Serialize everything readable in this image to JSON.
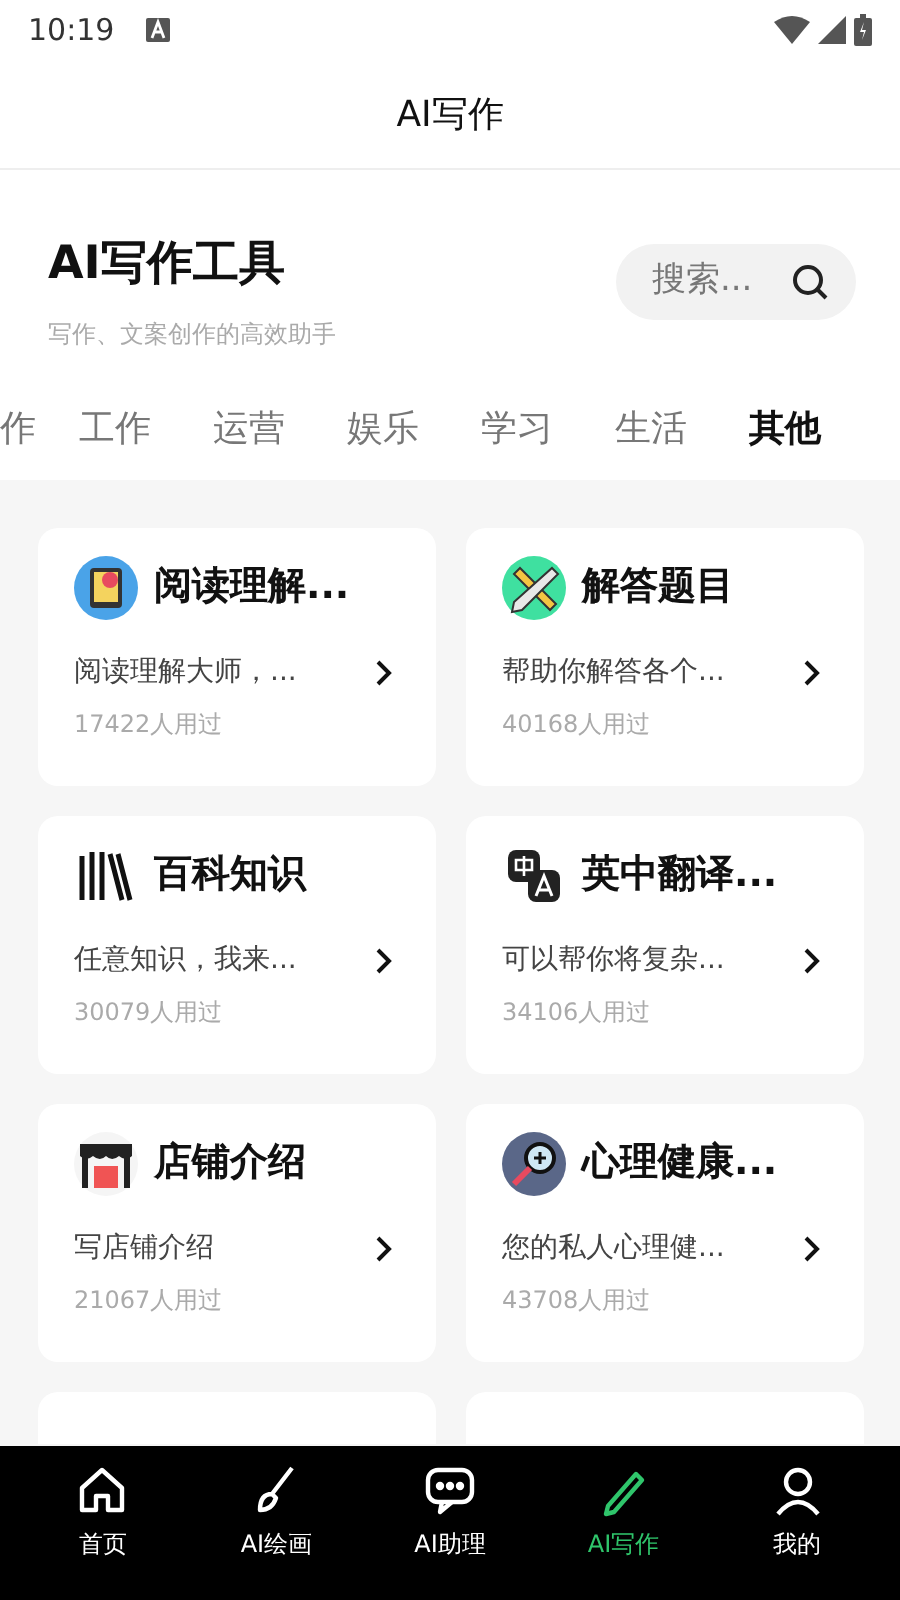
{
  "status_bar": {
    "time": "10:19"
  },
  "title_bar": {
    "title": "AI写作"
  },
  "header": {
    "title": "AI写作工具",
    "subtitle": "写作、文案创作的高效助手",
    "search": {
      "placeholder": "搜索..."
    }
  },
  "tabs": [
    {
      "label": "作",
      "selected": false
    },
    {
      "label": "工作",
      "selected": false
    },
    {
      "label": "运营",
      "selected": false
    },
    {
      "label": "娱乐",
      "selected": false
    },
    {
      "label": "学习",
      "selected": false
    },
    {
      "label": "生活",
      "selected": false
    },
    {
      "label": "其他",
      "selected": true
    }
  ],
  "tools": [
    {
      "kind": "book",
      "title": "阅读理解...",
      "description": "阅读理解大师，...",
      "usage": "17422人用过"
    },
    {
      "kind": "ruler",
      "title": "解答题目",
      "description": "帮助你解答各个...",
      "usage": "40168人用过"
    },
    {
      "kind": "books",
      "title": "百科知识",
      "description": "任意知识，我来...",
      "usage": "30079人用过"
    },
    {
      "kind": "translate",
      "title": "英中翻译...",
      "description": "可以帮你将复杂...",
      "usage": "34106人用过"
    },
    {
      "kind": "shop",
      "title": "店铺介绍",
      "description": "写店铺介绍",
      "usage": "21067人用过"
    },
    {
      "kind": "magnifier",
      "title": "心理健康...",
      "description": "您的私人心理健...",
      "usage": "43708人用过"
    },
    {
      "kind": "cut_off"
    },
    {
      "kind": "cut_off"
    }
  ],
  "bottom_nav": [
    {
      "kind": "home",
      "label": "首页",
      "selected": false
    },
    {
      "kind": "brush",
      "label": "AI绘画",
      "selected": false
    },
    {
      "kind": "chat",
      "label": "AI助理",
      "selected": false
    },
    {
      "kind": "pen",
      "label": "AI写作",
      "selected": true
    },
    {
      "kind": "user",
      "label": "我的",
      "selected": false
    }
  ]
}
